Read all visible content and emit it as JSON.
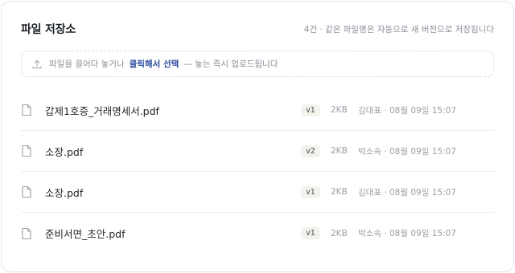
{
  "header": {
    "title": "파일 저장소",
    "meta": "4건 · 같은 파일명은 자동으로 새 버전으로 저장됩니다"
  },
  "dropzone": {
    "text_before": "파일을 끌어다 놓거나",
    "link": "클릭해서 선택",
    "text_after": "— 놓는 즉시 업로드됩니다",
    "icon": "upload-icon"
  },
  "files": [
    {
      "name": "갑제1호증_거래명세서.pdf",
      "version": "v1",
      "size": "2KB",
      "info": "김대표 · 08월 09일 15:07",
      "icon": "file-icon"
    },
    {
      "name": "소장.pdf",
      "version": "v2",
      "size": "2KB",
      "info": "박소속 · 08월 09일 15:07",
      "icon": "file-icon"
    },
    {
      "name": "소장.pdf",
      "version": "v1",
      "size": "2KB",
      "info": "김대표 · 08월 09일 15:07",
      "icon": "file-icon"
    },
    {
      "name": "준비서면_초안.pdf",
      "version": "v1",
      "size": "2KB",
      "info": "박소속 · 08월 09일 15:07",
      "icon": "file-icon"
    }
  ]
}
